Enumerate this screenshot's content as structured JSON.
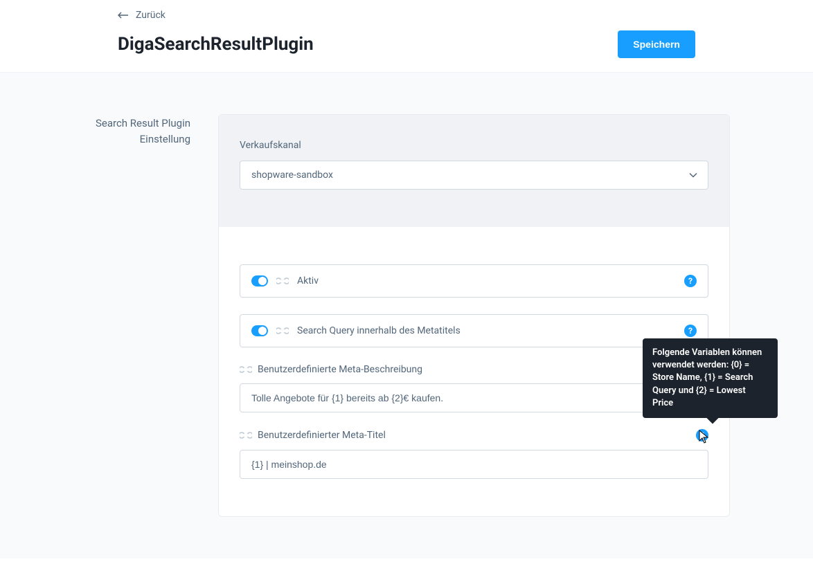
{
  "header": {
    "back_label": "Zurück",
    "title": "DigaSearchResultPlugin",
    "save_label": "Speichern"
  },
  "sidebar": {
    "section_title": "Search Result Plugin Einstellung"
  },
  "sales_channel": {
    "label": "Verkaufskanal",
    "value": "shopware-sandbox"
  },
  "toggles": {
    "active": {
      "label": "Aktiv"
    },
    "search_query_meta": {
      "label": "Search Query innerhalb des Metatitels"
    }
  },
  "fields": {
    "meta_description": {
      "label": "Benutzerdefinierte Meta-Beschreibung",
      "value": "Tolle Angebote für {1} bereits ab {2}€ kaufen."
    },
    "meta_title": {
      "label": "Benutzerdefinierter Meta-Titel",
      "value": "{1} | meinshop.de"
    }
  },
  "tooltip": {
    "text": "Folgende Variablen können verwendet werden: {0} = Store Name, {1} = Search Query und {2} = Lowest Price"
  },
  "icons": {
    "help": "?"
  }
}
